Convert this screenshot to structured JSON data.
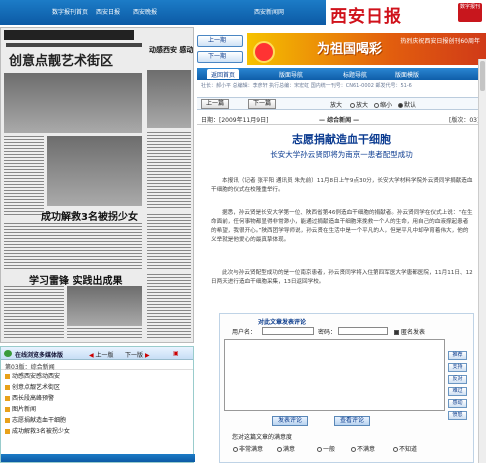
{
  "top_nav": {
    "items": [
      "数字报刊首页",
      "西安日报",
      "西安晚报",
      "西安新闻网"
    ],
    "logo_text": "西安日报",
    "badge_text": "数字报刊"
  },
  "newspaper_page": {
    "headlines": [
      "创意点靓艺术街区",
      "动感西安 感动西安",
      "成功解救3名被拐少女",
      "学习雷锋 实践出成果"
    ]
  },
  "media": {
    "title": "在线浏览多媒体版",
    "prev": "上一版",
    "next": "下一版",
    "section": "第03版：综合新闻",
    "items": [
      "动感西安感动西安",
      "创意点靓艺术街区",
      "西长段高峰预警",
      "图片新闻",
      "志愿捐献造血干细胞",
      "成功解救3名被拐少女"
    ]
  },
  "page_nav": {
    "prev": "上一期",
    "next": "下一期"
  },
  "banner": {
    "title": "为祖国喝彩",
    "subtitle": "热烈庆祝西安日报创刊60周年"
  },
  "tabs": [
    "返回首页",
    "版面导航",
    "标题导航",
    "版面模版"
  ],
  "infobar": "社长：郝小平  总编辑：李彦轩  执行总编：宋宏虹  国内统一刊号：CN61-0002  邮发代号：51-6",
  "toolbar": {
    "prev": "上一篇",
    "next": "下一篇",
    "zoom_label": "放大",
    "zoom_options": [
      "放大",
      "缩小",
      "默认"
    ]
  },
  "dateline": {
    "date": "日期：[2009年11月9日]",
    "section": "— 综合新闻 —",
    "edition": "[版次：03]"
  },
  "article": {
    "title": "志愿捐献造血干细胞",
    "subtitle": "长安大学孙云贤即将为南京一患者配型成功",
    "paragraphs": [
      "本报讯（记者 张平阳 通讯员 朱先前）11月8日上午9点30分，长安大学材料学院外云贤同学捐献造血干细胞的仪式在校隆重举行。",
      "据悉，孙云贤是长安大学第一位、陕西省第46例造血干细胞的捐献者。孙云贤同学在仪式上说：“在生命面前，任何事物都显得非常渺小，能通过捐献造血干细胞来挽救一个人的生命，用自己的血液撑起患者的希望，我很开心。”陕西团学导师说，孙云贤在生活中是一个平凡的人，但是平凡中却孕育着伟大，他的义举就是他爱心的最真挚体现。",
      "此次与孙云贤配型成功的是一位南京患者，孙云贤同学将入住第四军医大学唐都医院，11月11日、12日两天进行造血干细胞采集，13日返回学校。"
    ]
  },
  "comment": {
    "title": "对此文章发表评论",
    "username_label": "用户名：",
    "password_label": "密码：",
    "anonymous_label": "匿名发表",
    "side_buttons": [
      "推荐",
      "支持",
      "反对",
      "难过",
      "感动",
      "愤怒"
    ],
    "submit": "发表评论",
    "view": "查看评论",
    "rating_question": "您对这篇文章的满意度",
    "ratings": [
      "非常满意",
      "满意",
      "一般",
      "不满意",
      "不知道"
    ]
  }
}
